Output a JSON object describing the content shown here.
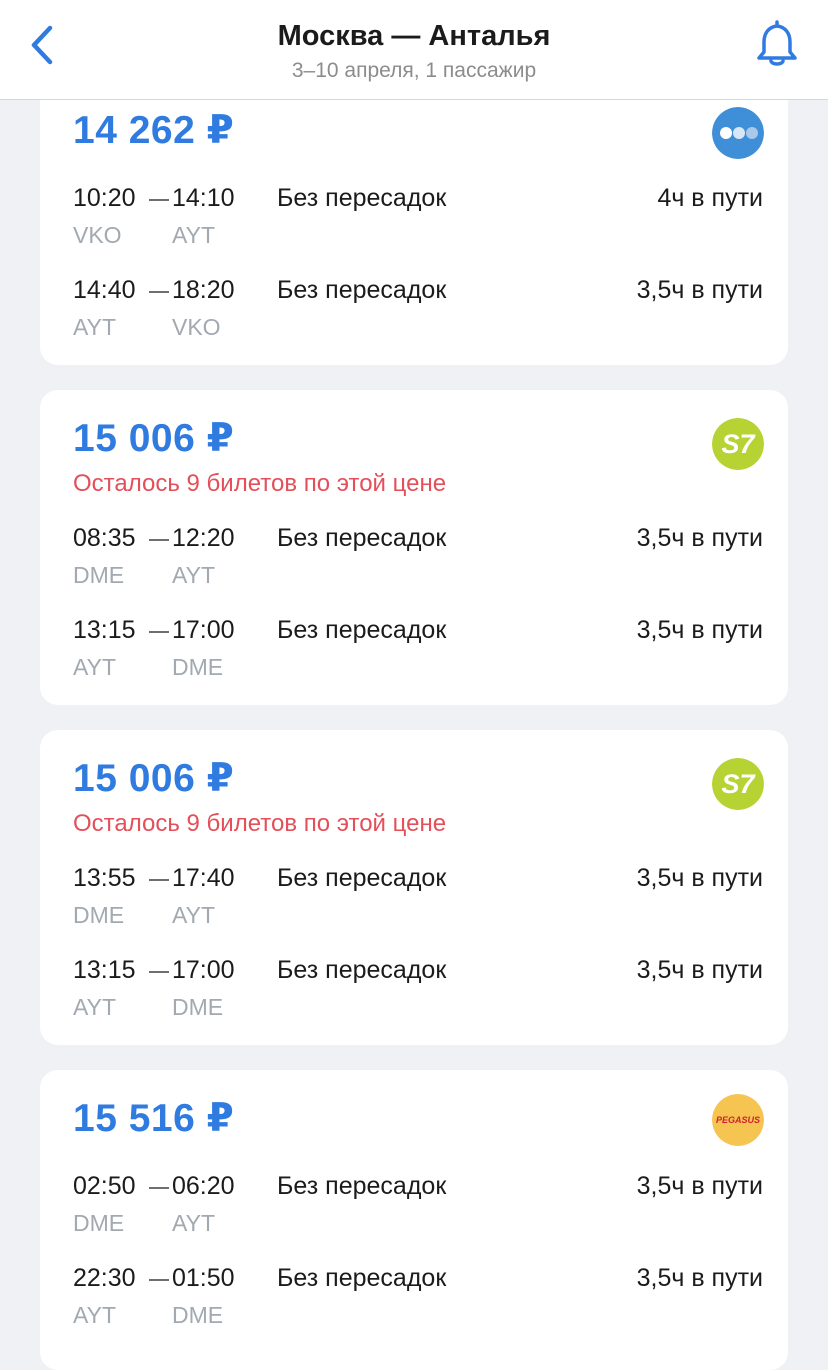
{
  "header": {
    "title": "Москва — Анталья",
    "subtitle": "3–10 апреля, 1 пассажир"
  },
  "colors": {
    "accent": "#2f7be0",
    "warning": "#e44f5a",
    "background": "#eff1f4",
    "s7_logo": "#b7d333",
    "pegasus_logo": "#f5c451",
    "generic_logo": "#3f8fd8"
  },
  "icons": {
    "back": "chevron-left-icon",
    "bell": "bell-icon"
  },
  "offers": [
    {
      "price": "14 262 ₽",
      "warning": "",
      "airline_logo": "generic-airline-logo",
      "segments": [
        {
          "dep_time": "10:20",
          "arr_time": "14:10",
          "dep_code": "VKO",
          "arr_code": "AYT",
          "stops": "Без пересадок",
          "duration": "4ч в пути"
        },
        {
          "dep_time": "14:40",
          "arr_time": "18:20",
          "dep_code": "AYT",
          "arr_code": "VKO",
          "stops": "Без пересадок",
          "duration": "3,5ч в пути"
        }
      ]
    },
    {
      "price": "15 006 ₽",
      "warning": "Осталось 9 билетов по этой цене",
      "airline_logo": "s7-logo",
      "segments": [
        {
          "dep_time": "08:35",
          "arr_time": "12:20",
          "dep_code": "DME",
          "arr_code": "AYT",
          "stops": "Без пересадок",
          "duration": "3,5ч в пути"
        },
        {
          "dep_time": "13:15",
          "arr_time": "17:00",
          "dep_code": "AYT",
          "arr_code": "DME",
          "stops": "Без пересадок",
          "duration": "3,5ч в пути"
        }
      ]
    },
    {
      "price": "15 006 ₽",
      "warning": "Осталось 9 билетов по этой цене",
      "airline_logo": "s7-logo",
      "segments": [
        {
          "dep_time": "13:55",
          "arr_time": "17:40",
          "dep_code": "DME",
          "arr_code": "AYT",
          "stops": "Без пересадок",
          "duration": "3,5ч в пути"
        },
        {
          "dep_time": "13:15",
          "arr_time": "17:00",
          "dep_code": "AYT",
          "arr_code": "DME",
          "stops": "Без пересадок",
          "duration": "3,5ч в пути"
        }
      ]
    },
    {
      "price": "15 516 ₽",
      "warning": "",
      "airline_logo": "pegasus-logo",
      "logo_text": "PEGASUS",
      "segments": [
        {
          "dep_time": "02:50",
          "arr_time": "06:20",
          "dep_code": "DME",
          "arr_code": "AYT",
          "stops": "Без пересадок",
          "duration": "3,5ч в пути"
        },
        {
          "dep_time": "22:30",
          "arr_time": "01:50",
          "dep_code": "AYT",
          "arr_code": "DME",
          "stops": "Без пересадок",
          "duration": "3,5ч в пути"
        }
      ]
    }
  ]
}
